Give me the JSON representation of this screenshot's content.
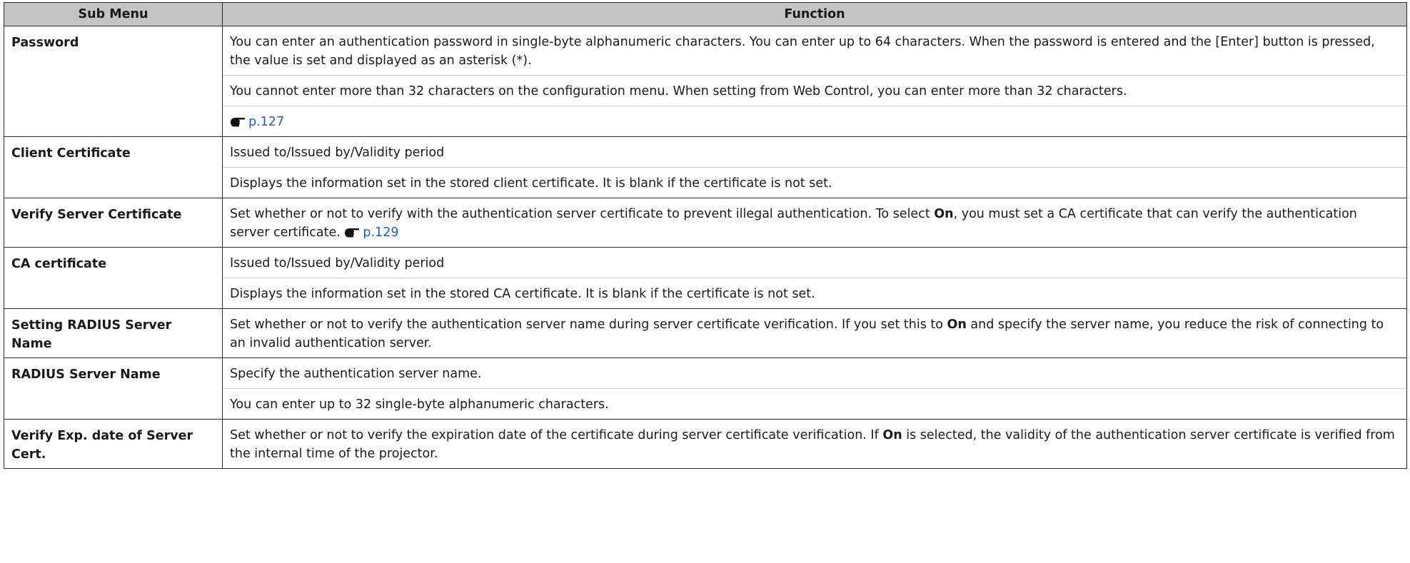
{
  "table": {
    "headers": {
      "sub_menu": "Sub Menu",
      "function": "Function"
    },
    "rows": [
      {
        "sub_menu": "Password",
        "p1": "You can enter an authentication password in single-byte alphanumeric characters. You can enter up to 64 characters. When the password is entered and the [Enter] button is pressed, the value is set and displayed as an asterisk (*).",
        "p2": "You cannot enter more than 32 characters on the configuration menu. When setting from Web Control, you can enter more than 32 characters.",
        "ref": "p.127"
      },
      {
        "sub_menu": "Client Certificate",
        "head": "Issued to/Issued by/Validity period",
        "p1": "Displays the information set in the stored client certificate. It is blank if the certificate is not set."
      },
      {
        "sub_menu": "Verify Server Certificate",
        "p1a": "Set whether or not to verify with the authentication server certificate to prevent illegal authentication. To select ",
        "bold": "On",
        "p1b": ", you must set a CA certificate that can verify the authentication server certificate. ",
        "ref": "p.129"
      },
      {
        "sub_menu": "CA certificate",
        "head": "Issued to/Issued by/Validity period",
        "p1": "Displays the information set in the stored CA certificate. It is blank if the certificate is not set."
      },
      {
        "sub_menu": "Setting RADIUS Server Name",
        "p1a": "Set whether or not to verify the authentication server name during server certificate verification. If you set this to ",
        "bold": "On",
        "p1b": " and specify the server name, you reduce the risk of connecting to an invalid authentication server."
      },
      {
        "sub_menu": "RADIUS Server Name",
        "p1": "Specify the authentication server name.",
        "p2": "You can enter up to 32 single-byte alphanumeric characters."
      },
      {
        "sub_menu": "Verify Exp. date of Server Cert.",
        "p1a": "Set whether or not to verify the expiration date of the certificate during server certificate verification. If ",
        "bold": "On",
        "p1b": " is selected, the validity of the authentication server certificate is verified from the internal time of the projector."
      }
    ]
  },
  "icons": {
    "reference": "pointing-hand-icon"
  },
  "colors": {
    "header_bg": "#c4c4c4",
    "link": "#1a5fd4",
    "border": "#2b2b2b"
  }
}
